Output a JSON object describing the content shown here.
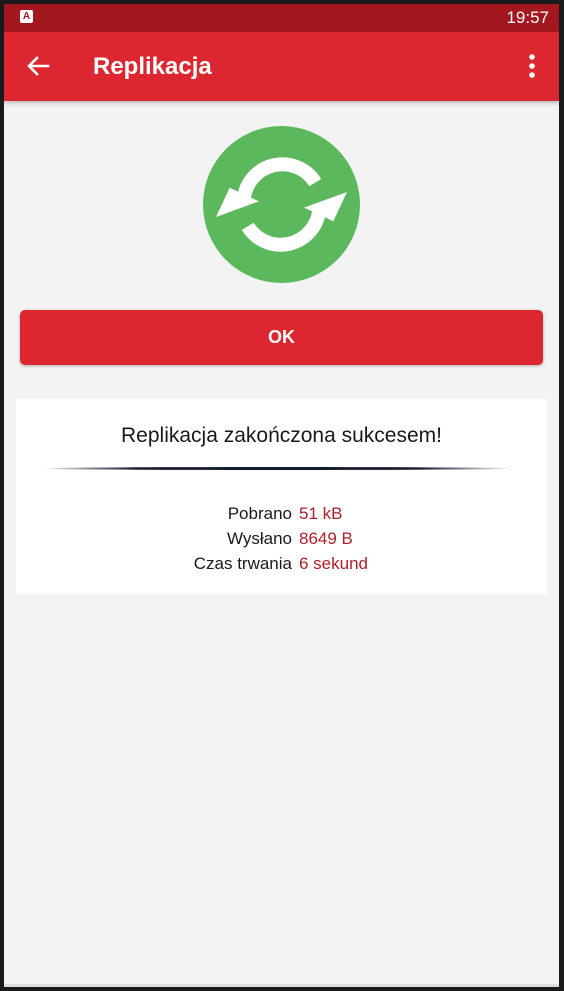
{
  "status_bar": {
    "app_icon": "A",
    "time": "19:57"
  },
  "app_bar": {
    "back_icon": "arrow-left-icon",
    "title": "Replikacja",
    "menu_icon": "more-vert-icon"
  },
  "sync_icon": "sync-icon",
  "ok_button": {
    "label": "OK"
  },
  "result": {
    "message": "Replikacja zakończona sukcesem!",
    "stats": [
      {
        "label": "Pobrano",
        "value": "51 kB"
      },
      {
        "label": "Wysłano",
        "value": "8649 B"
      },
      {
        "label": "Czas trwania",
        "value": "6 sekund"
      }
    ]
  },
  "colors": {
    "status_bar": "#a3171e",
    "app_bar": "#dc2630",
    "button": "#dc2630",
    "success_green": "#5cb85c",
    "value_text": "#b01f28",
    "background": "#f3f3f3"
  }
}
